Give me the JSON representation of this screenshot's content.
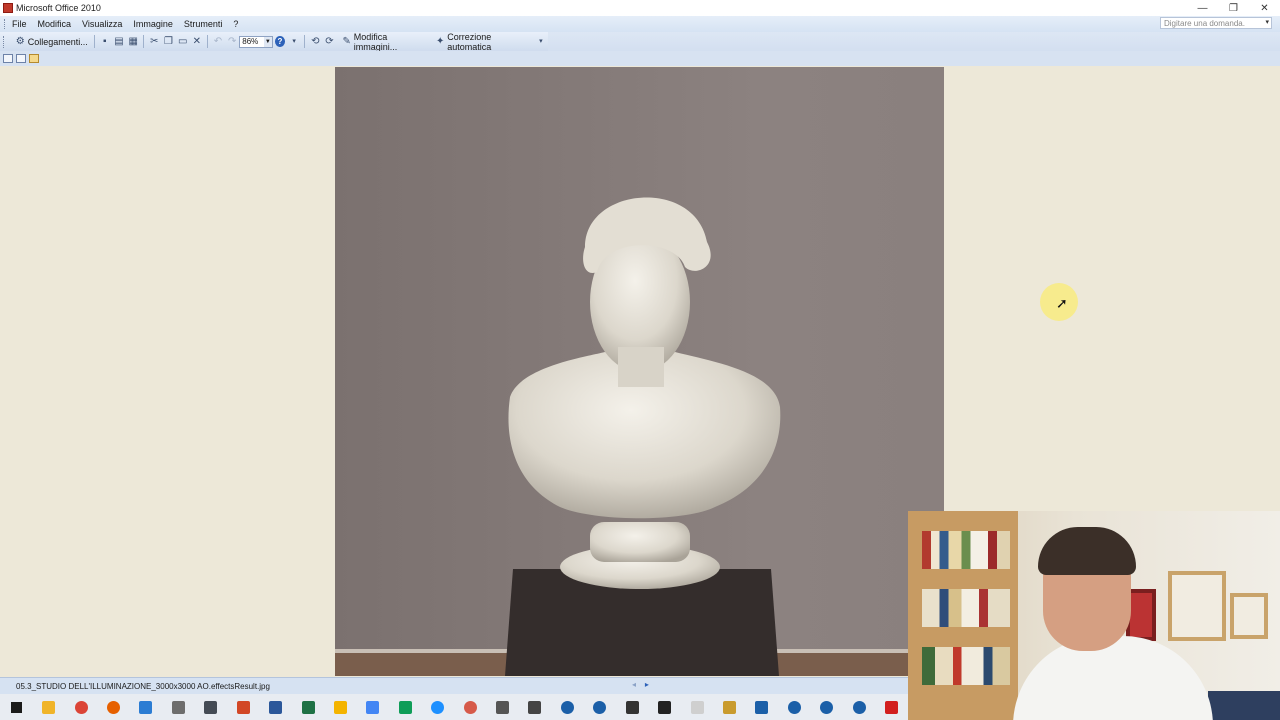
{
  "window": {
    "title": "Microsoft Office 2010",
    "controls": {
      "minimize": "—",
      "restore": "❐",
      "close": "✕"
    }
  },
  "menu": {
    "items": [
      "File",
      "Modifica",
      "Visualizza",
      "Immagine",
      "Strumenti",
      "?"
    ],
    "search_placeholder": "Digitare una domanda."
  },
  "toolbar": {
    "links_label": "Collegamenti...",
    "zoom_value": "86%",
    "edit_images_label": "Modifica immagini...",
    "autocorrect_label": "Correzione automatica"
  },
  "statusbar": {
    "filename": "05.3_STUDIO DELL'ILLUMINAZIONE_3000x3000 AO.effectsResult.jpg"
  },
  "taskbar": {
    "icons": [
      "windows-start-icon",
      "file-explorer-icon",
      "chrome-icon",
      "firefox-icon",
      "outlook-icon",
      "pen-tool-icon",
      "calculator-icon",
      "powerpoint-icon",
      "word-icon",
      "excel-icon",
      "keep-notes-icon",
      "google-docs-icon",
      "google-sheets-icon",
      "edge-browser-icon",
      "search-app-icon",
      "monitor-icon",
      "window-app-icon",
      "sketchup-icon",
      "shield-app-icon",
      "paw-app-icon",
      "clock-app-icon",
      "blank-app-icon",
      "paint-app-icon",
      "layout-app-icon",
      "sketchup-icon-2",
      "sketchup-icon-3",
      "sketchup-icon-4",
      "acrobat-icon"
    ],
    "colors": [
      "#1b1b1b",
      "#f0b429",
      "#db4437",
      "#e66000",
      "#2b7cd3",
      "#6d6d6d",
      "#444b55",
      "#d24726",
      "#2b579a",
      "#1e7145",
      "#f4b400",
      "#4285f4",
      "#0f9d58",
      "#1e90ff",
      "#d65a4a",
      "#555",
      "#444",
      "#1b5fa8",
      "#1b5fa8",
      "#333",
      "#222",
      "#cfcfcf",
      "#c99b2e",
      "#1b5fa8",
      "#1b5fa8",
      "#1b5fa8",
      "#1b5fa8",
      "#d21f1f"
    ]
  }
}
